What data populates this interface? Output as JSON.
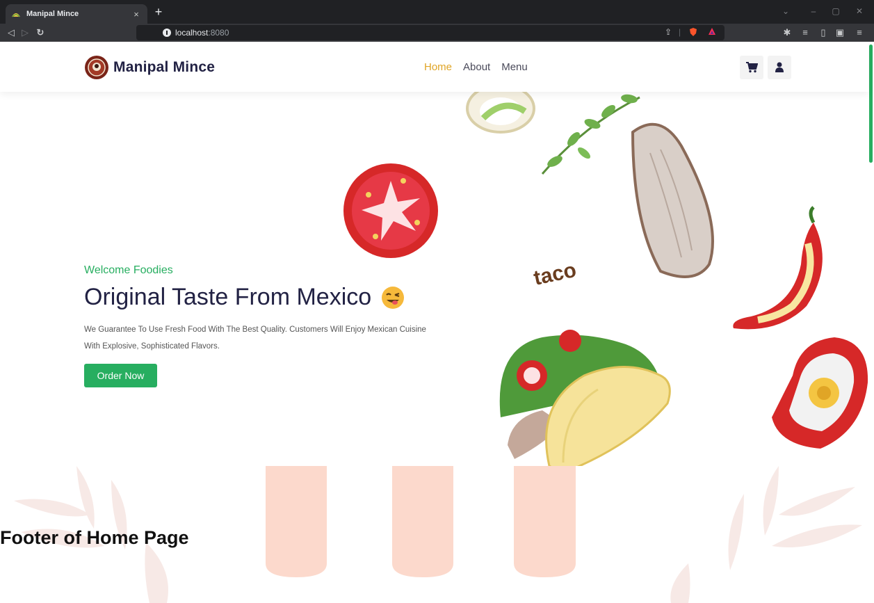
{
  "browser": {
    "tab_title": "Manipal Mince",
    "tab_close": "×",
    "new_tab": "+",
    "url_host": "localhost",
    "url_port": ":8080"
  },
  "site": {
    "brand_name": "Manipal Mince",
    "nav": [
      {
        "label": "Home",
        "active": true
      },
      {
        "label": "About",
        "active": false
      },
      {
        "label": "Menu",
        "active": false
      }
    ],
    "icons": {
      "cart": "cart-icon",
      "user": "user-icon"
    },
    "colors": {
      "accent_green": "#27ae60",
      "nav_active": "#e0a526",
      "title": "#222244"
    }
  },
  "hero": {
    "subtitle": "Welcome Foodies",
    "title": "Original Taste From Mexico",
    "description": "We Guarantee To Use Fresh Food With The Best Quality. Customers Will Enjoy Mexican Cuisine With Explosive, Sophisticated Flavors.",
    "cta_label": "Order Now",
    "art_text": "taco"
  },
  "document": {
    "heading": "Footer of Home Page"
  }
}
